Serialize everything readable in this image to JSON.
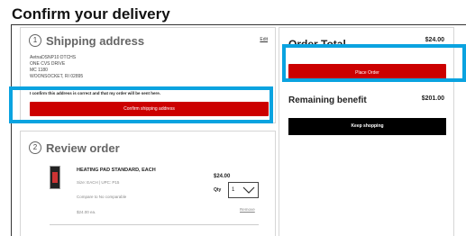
{
  "page": {
    "title": "Confirm your delivery"
  },
  "shipping": {
    "step": "1",
    "title": "Shipping address",
    "edit_label": "Edit",
    "address_lines": [
      "AetnaDSNP10 DTCHS",
      "ONE CVS DRIVE",
      "MC 1180",
      "WOONSOCKET, RI 02895"
    ],
    "confirm_text": "I confirm this address is correct and that my order will be sent here.",
    "confirm_button": "Confirm shipping address"
  },
  "review": {
    "step": "2",
    "title": "Review order",
    "product": {
      "name": "HEATING PAD STANDARD, EACH",
      "meta": "Size: EACH | UPC: P15",
      "compare": "Compare to No comparable",
      "unit_price": "$24.00 ea.",
      "price": "$24.00",
      "qty_label": "Qty",
      "qty_value": "1",
      "remove_label": "Remove"
    }
  },
  "summary": {
    "total_label": "Order Total",
    "total_value": "$24.00",
    "place_order_button": "Place Order",
    "benefit_label": "Remaining benefit",
    "benefit_value": "$201.00",
    "keep_shopping_button": "Keep shopping"
  },
  "colors": {
    "accent_red": "#cc0000",
    "highlight_blue": "#0aa3e0"
  }
}
